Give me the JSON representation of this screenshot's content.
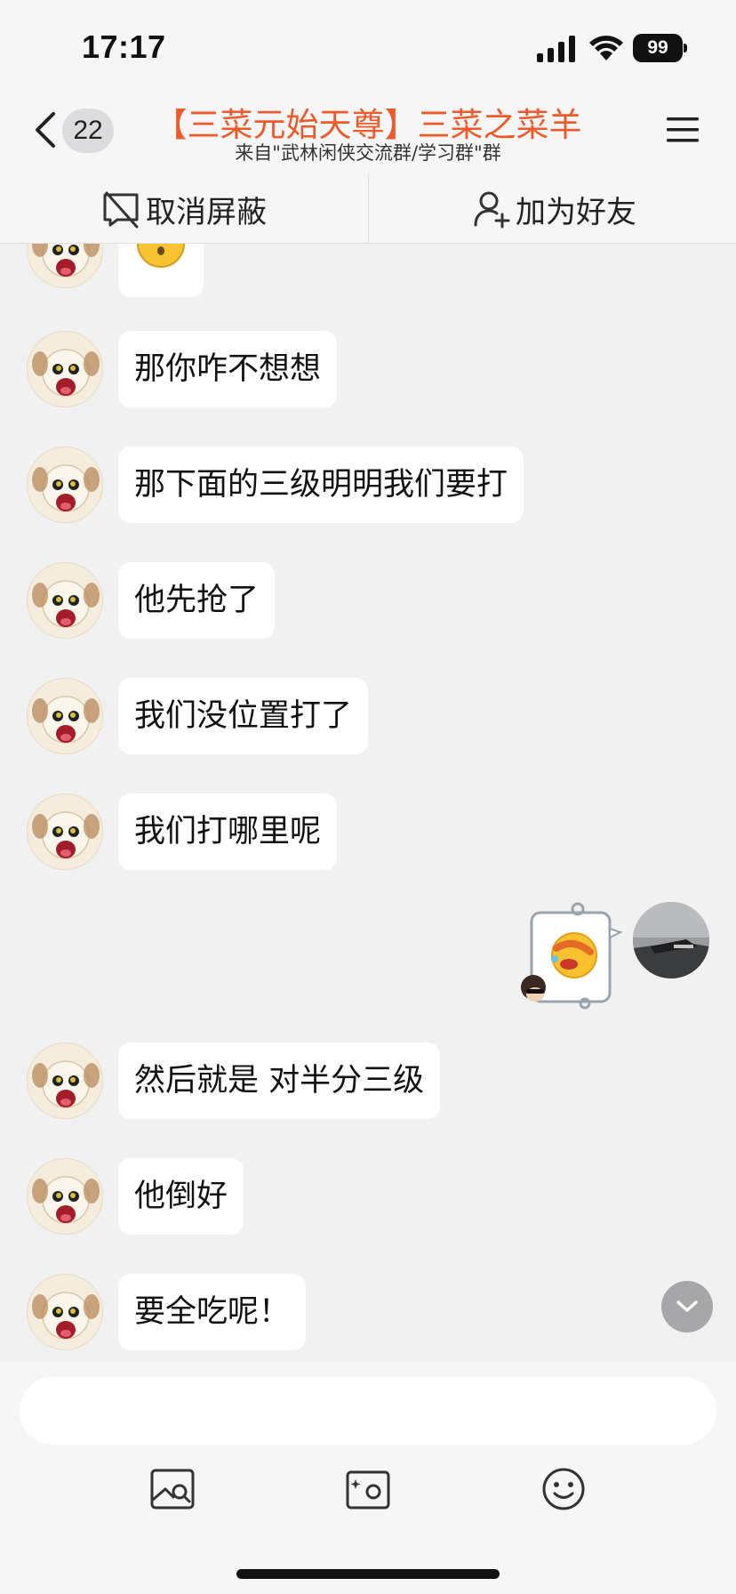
{
  "status_bar": {
    "time": "17:17",
    "battery": "99",
    "icons": [
      "signal-icon",
      "wifi-icon",
      "battery-icon"
    ]
  },
  "header": {
    "unread_count": "22",
    "title": "【三菜元始天尊】三菜之菜羊",
    "subtitle": "来自\"武林闲侠交流群/学习群\"群",
    "icons": [
      "back-icon",
      "menu-icon"
    ]
  },
  "actions": {
    "unblock_label": "取消屏蔽",
    "add_friend_label": "加为好友"
  },
  "messages": [
    {
      "side": "left",
      "type": "sticker",
      "text": ""
    },
    {
      "side": "left",
      "type": "text",
      "text": "那你咋不想想"
    },
    {
      "side": "left",
      "type": "text",
      "text": "那下面的三级明明我们要打"
    },
    {
      "side": "left",
      "type": "text",
      "text": "他先抢了"
    },
    {
      "side": "left",
      "type": "text",
      "text": "我们没位置打了"
    },
    {
      "side": "left",
      "type": "text",
      "text": "我们打哪里呢"
    },
    {
      "side": "right",
      "type": "sticker",
      "text": ""
    },
    {
      "side": "left",
      "type": "text",
      "text": "然后就是 对半分三级"
    },
    {
      "side": "left",
      "type": "text",
      "text": "他倒好"
    },
    {
      "side": "left",
      "type": "text",
      "text": "要全吃呢！"
    }
  ],
  "input": {
    "value": "",
    "placeholder": ""
  },
  "toolbar": {
    "icons": [
      "image-icon",
      "camera-icon",
      "emoji-icon"
    ]
  },
  "colors": {
    "title": "#ee5a2b",
    "background": "#f1f1f2",
    "bubble": "#ffffff"
  }
}
